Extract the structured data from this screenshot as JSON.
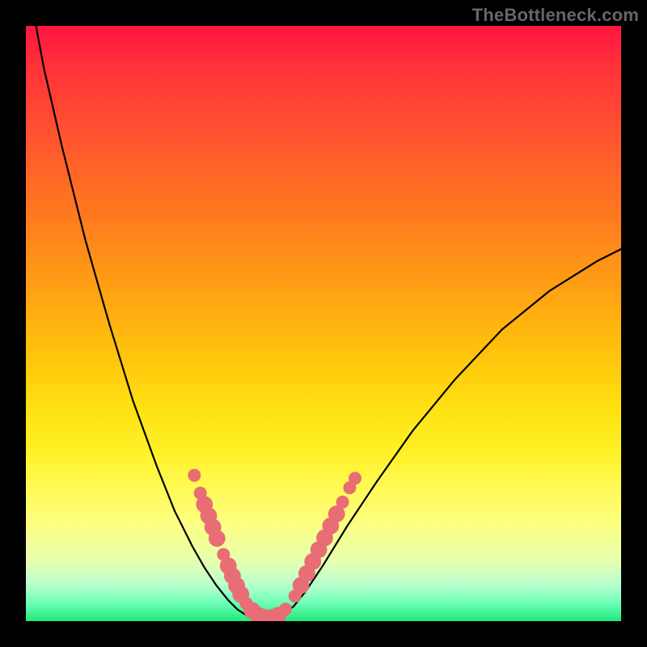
{
  "watermark": "TheBottleneck.com",
  "colors": {
    "background": "#000000",
    "curve_stroke": "#000000",
    "bead_fill": "#e86d74",
    "gradient_stops": [
      {
        "stop": 0.0,
        "color": "#ff153e"
      },
      {
        "stop": 0.06,
        "color": "#ff2f3a"
      },
      {
        "stop": 0.18,
        "color": "#ff5230"
      },
      {
        "stop": 0.32,
        "color": "#ff7a1e"
      },
      {
        "stop": 0.45,
        "color": "#ffa313"
      },
      {
        "stop": 0.56,
        "color": "#ffc60c"
      },
      {
        "stop": 0.65,
        "color": "#ffe313"
      },
      {
        "stop": 0.72,
        "color": "#fff22a"
      },
      {
        "stop": 0.78,
        "color": "#fffb58"
      },
      {
        "stop": 0.84,
        "color": "#fbff84"
      },
      {
        "stop": 0.9,
        "color": "#e6ffb0"
      },
      {
        "stop": 0.94,
        "color": "#b6ffcf"
      },
      {
        "stop": 0.97,
        "color": "#6cffb5"
      },
      {
        "stop": 1.0,
        "color": "#22e87a"
      }
    ]
  },
  "chart_data": {
    "type": "line",
    "title": "",
    "xlabel": "",
    "ylabel": "",
    "description": "Single asymmetric V-shaped bottleneck curve over a vertical red-to-green gradient. The minimum (near y=0) indicates the no-bottleneck point; pink beads highlight the near-optimal region around the trough.",
    "x_range": [
      0,
      1
    ],
    "y_range": [
      0,
      1
    ],
    "series": [
      {
        "name": "bottleneck-curve",
        "x": [
          0.017,
          0.03,
          0.06,
          0.1,
          0.14,
          0.18,
          0.22,
          0.25,
          0.28,
          0.3,
          0.32,
          0.34,
          0.355,
          0.37,
          0.385,
          0.4,
          0.415,
          0.43,
          0.45,
          0.47,
          0.5,
          0.54,
          0.59,
          0.65,
          0.72,
          0.8,
          0.88,
          0.96,
          1.0
        ],
        "y": [
          1.0,
          0.93,
          0.8,
          0.64,
          0.5,
          0.37,
          0.26,
          0.185,
          0.125,
          0.09,
          0.06,
          0.035,
          0.02,
          0.01,
          0.004,
          0.002,
          0.004,
          0.01,
          0.025,
          0.05,
          0.095,
          0.16,
          0.235,
          0.32,
          0.405,
          0.49,
          0.555,
          0.605,
          0.625
        ]
      }
    ],
    "trough_x": 0.4,
    "trough_y": 0.002,
    "beads": {
      "description": "pink markers clustered on both branches near the trough (approx. y ≤ 0.26)",
      "points": [
        {
          "x": 0.283,
          "y": 0.245,
          "r": 1.0
        },
        {
          "x": 0.293,
          "y": 0.215,
          "r": 1.0
        },
        {
          "x": 0.3,
          "y": 0.196,
          "r": 1.3
        },
        {
          "x": 0.307,
          "y": 0.177,
          "r": 1.3
        },
        {
          "x": 0.314,
          "y": 0.158,
          "r": 1.3
        },
        {
          "x": 0.321,
          "y": 0.139,
          "r": 1.3
        },
        {
          "x": 0.332,
          "y": 0.112,
          "r": 1.0
        },
        {
          "x": 0.34,
          "y": 0.093,
          "r": 1.3
        },
        {
          "x": 0.347,
          "y": 0.076,
          "r": 1.3
        },
        {
          "x": 0.354,
          "y": 0.06,
          "r": 1.3
        },
        {
          "x": 0.361,
          "y": 0.045,
          "r": 1.3
        },
        {
          "x": 0.37,
          "y": 0.03,
          "r": 1.0
        },
        {
          "x": 0.38,
          "y": 0.018,
          "r": 1.3
        },
        {
          "x": 0.39,
          "y": 0.01,
          "r": 1.3
        },
        {
          "x": 0.4,
          "y": 0.006,
          "r": 1.3
        },
        {
          "x": 0.412,
          "y": 0.006,
          "r": 1.3
        },
        {
          "x": 0.424,
          "y": 0.01,
          "r": 1.3
        },
        {
          "x": 0.436,
          "y": 0.02,
          "r": 1.0
        },
        {
          "x": 0.452,
          "y": 0.042,
          "r": 1.0
        },
        {
          "x": 0.462,
          "y": 0.06,
          "r": 1.3
        },
        {
          "x": 0.472,
          "y": 0.08,
          "r": 1.3
        },
        {
          "x": 0.482,
          "y": 0.1,
          "r": 1.3
        },
        {
          "x": 0.492,
          "y": 0.12,
          "r": 1.3
        },
        {
          "x": 0.502,
          "y": 0.14,
          "r": 1.3
        },
        {
          "x": 0.512,
          "y": 0.16,
          "r": 1.3
        },
        {
          "x": 0.522,
          "y": 0.18,
          "r": 1.3
        },
        {
          "x": 0.532,
          "y": 0.2,
          "r": 1.0
        },
        {
          "x": 0.544,
          "y": 0.224,
          "r": 1.0
        },
        {
          "x": 0.553,
          "y": 0.24,
          "r": 1.0
        }
      ],
      "base_radius_px": 8
    }
  }
}
